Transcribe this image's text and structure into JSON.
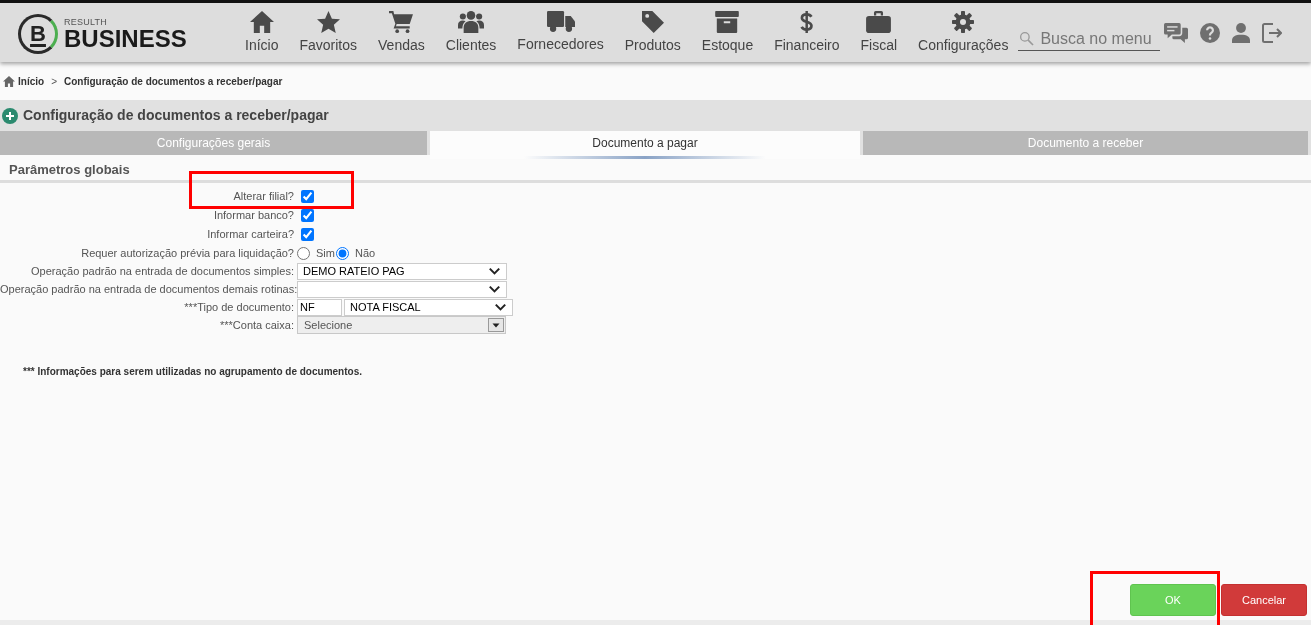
{
  "header": {
    "logo": {
      "mark": "B",
      "tagline": "RESULTH",
      "name": "BUSINESS"
    },
    "nav": [
      "Início",
      "Favoritos",
      "Vendas",
      "Clientes",
      "Fornecedores",
      "Produtos",
      "Estoque",
      "Financeiro",
      "Fiscal",
      "Configurações"
    ],
    "search": {
      "placeholder": "Busca no menu"
    }
  },
  "breadcrumb": {
    "items": [
      "Início",
      "Configuração de documentos a receber/pagar"
    ],
    "separator": ">"
  },
  "page_title": "Configuração de documentos a receber/pagar",
  "tabs": [
    {
      "label": "Configurações gerais",
      "selected": false
    },
    {
      "label": "Documento a pagar",
      "selected": true
    },
    {
      "label": "Documento a receber",
      "selected": false
    }
  ],
  "section": {
    "title": "Parâmetros globais"
  },
  "fields": [
    {
      "kind": "checkbox",
      "label": "Alterar filial?",
      "checked": true,
      "highlighted": true
    },
    {
      "kind": "checkbox",
      "label": "Informar banco?",
      "checked": true,
      "highlighted": false
    },
    {
      "kind": "checkbox",
      "label": "Informar carteira?",
      "checked": true,
      "highlighted": false
    },
    {
      "kind": "radio",
      "label": "Requer autorização prévia para liquidação?",
      "options": [
        {
          "label": "Sim",
          "selected": false
        },
        {
          "label": "Não",
          "selected": true
        }
      ],
      "highlighted": false
    },
    {
      "kind": "select",
      "label": "Operação padrão na entrada de documentos simples:",
      "value": "DEMO RATEIO PAG",
      "highlighted": false
    },
    {
      "kind": "select",
      "label": "Operação padrão na entrada de documentos demais rotinas:",
      "highlighted": false
    },
    {
      "kind": "code_select",
      "label": "***Tipo de documento:",
      "code": "NF",
      "value": "NOTA FISCAL",
      "highlighted": false
    },
    {
      "kind": "combo",
      "label": "***Conta caixa:",
      "value": "Selecione",
      "highlighted": false
    }
  ],
  "note": "*** Informações para serem utilizadas no agrupamento de documentos.",
  "buttons": [
    {
      "kind": "confirm",
      "label": "OK",
      "highlighted": true
    },
    {
      "kind": "cancel",
      "label": "Cancelar",
      "highlighted": false
    }
  ]
}
